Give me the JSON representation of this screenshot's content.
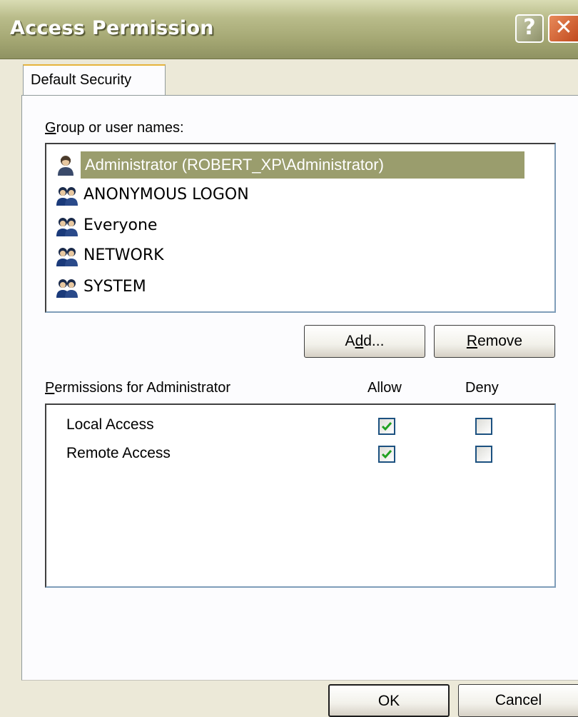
{
  "window": {
    "title": "Access Permission",
    "help_label": "?",
    "close_label": "✕"
  },
  "tab": {
    "label": "Default Security"
  },
  "groups": {
    "label_underline": "G",
    "label_rest": "roup or user names:",
    "items": [
      {
        "label": "Administrator (ROBERT_XP\\Administrator)",
        "icon": "user-icon",
        "selected": true
      },
      {
        "label": "ANONYMOUS LOGON",
        "icon": "group-icon",
        "selected": false
      },
      {
        "label": "Everyone",
        "icon": "group-icon",
        "selected": false
      },
      {
        "label": "NETWORK",
        "icon": "group-icon",
        "selected": false
      },
      {
        "label": "SYSTEM",
        "icon": "group-icon",
        "selected": false
      }
    ]
  },
  "buttons": {
    "add_pre": "A",
    "add_ul": "d",
    "add_post": "d...",
    "remove_ul": "R",
    "remove_rest": "emove",
    "ok": "OK",
    "cancel": "Cancel"
  },
  "permissions": {
    "label_underline": "P",
    "label_rest": "ermissions for Administrator",
    "allow_header": "Allow",
    "deny_header": "Deny",
    "rows": [
      {
        "name": "Local Access",
        "allow": true,
        "deny": false
      },
      {
        "name": "Remote Access",
        "allow": true,
        "deny": false
      }
    ]
  },
  "colors": {
    "selection": "#9a9d6d",
    "title_bar": "#a3a672",
    "check": "#21a121"
  }
}
